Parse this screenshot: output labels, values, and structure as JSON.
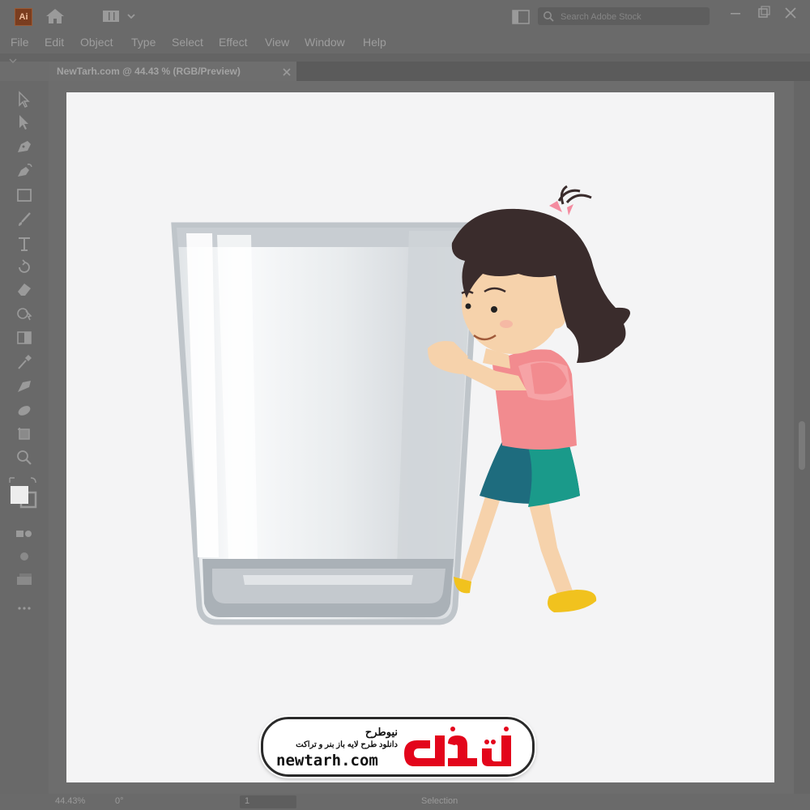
{
  "app": {
    "logo_text": "Ai",
    "search_placeholder": "Search Adobe Stock",
    "icons": [
      "home-icon",
      "workspace-icon",
      "chevron-down-icon",
      "arrange-documents-icon",
      "search-icon",
      "minimize-icon",
      "restore-icon",
      "close-icon"
    ]
  },
  "menu": [
    "File",
    "Edit",
    "Object",
    "Type",
    "Select",
    "Effect",
    "View",
    "Window",
    "Help"
  ],
  "document_tab": {
    "title": "NewTarh.com @ 44.43 % (RGB/Preview)"
  },
  "tools": [
    "selection-tool-icon",
    "direct-selection-tool-icon",
    "pen-tool-icon",
    "curvature-tool-icon",
    "rectangle-tool-icon",
    "paintbrush-tool-icon",
    "type-tool-icon",
    "rotate-tool-icon",
    "eraser-tool-icon",
    "shape-builder-tool-icon",
    "gradient-tool-icon",
    "eyedropper-tool-icon",
    "blend-tool-icon",
    "symbol-sprayer-tool-icon",
    "artboard-tool-icon",
    "zoom-tool-icon",
    "fill-stroke-swatch-icon",
    "drawing-modes-icon",
    "screen-mode-icon",
    "edit-toolbar-icon"
  ],
  "status": {
    "zoom": "44.43%",
    "rotation": "0°",
    "page": "1",
    "tool": "Selection"
  },
  "artwork": {
    "glass_color": "#c9ced3",
    "shirt_color": "#f28b8f",
    "skirt_color": "#1e6c7e",
    "hair_color": "#3a2c2c",
    "skin_color": "#f6d2ab",
    "shoe_color": "#f1c21e"
  },
  "watermark": {
    "title": "نیوطرح",
    "subtitle": "دانلود طرح لایه باز بنر و تراکت",
    "url": "newtarh.com",
    "brand_color": "#e3051b"
  }
}
